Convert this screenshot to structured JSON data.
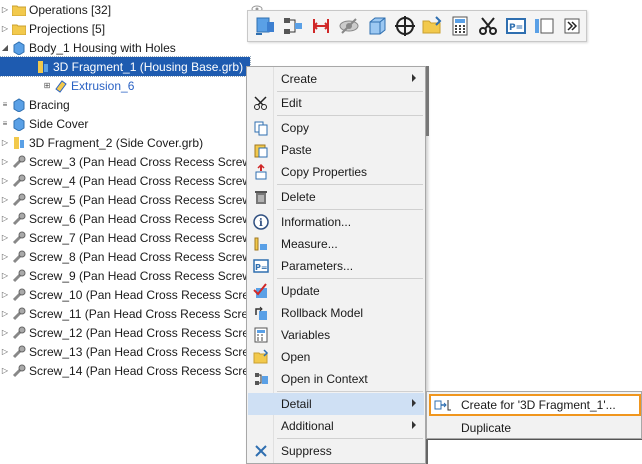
{
  "colors": {
    "selection": "#1e5bb0",
    "link": "#2a62c4",
    "menu_hover": "#cfe0f4",
    "submenu_focus": "#f0961e",
    "folder": "#f2c94c",
    "body_blue": "#5aa0e6"
  },
  "tree": {
    "rows": [
      {
        "label": "Operations [32]",
        "icon": "folder-icon",
        "expander": "▷"
      },
      {
        "label": "Projections [5]",
        "icon": "folder-icon",
        "expander": "▷"
      },
      {
        "label": "Body_1 Housing with Holes",
        "icon": "body-icon",
        "expander": "◢"
      },
      {
        "label": "3D Fragment_1 (Housing Base.grb)",
        "icon": "fragment-icon",
        "expander": "◢"
      },
      {
        "label": "Extrusion_6",
        "icon": "extrusion-icon",
        "expander": "⊞"
      },
      {
        "label": "Bracing",
        "icon": "body-icon",
        "expander": "≡"
      },
      {
        "label": "Side Cover",
        "icon": "body-icon",
        "expander": "≡"
      },
      {
        "label": "3D Fragment_2 (Side Cover.grb)",
        "icon": "fragment-icon",
        "expander": "▷"
      },
      {
        "label": "Screw_3 (Pan Head Cross Recess Screw I",
        "icon": "screw-icon",
        "expander": "▷"
      },
      {
        "label": "Screw_4 (Pan Head Cross Recess Screw I",
        "icon": "screw-icon",
        "expander": "▷"
      },
      {
        "label": "Screw_5 (Pan Head Cross Recess Screw I",
        "icon": "screw-icon",
        "expander": "▷"
      },
      {
        "label": "Screw_6 (Pan Head Cross Recess Screw I",
        "icon": "screw-icon",
        "expander": "▷"
      },
      {
        "label": "Screw_7 (Pan Head Cross Recess Screw I",
        "icon": "screw-icon",
        "expander": "▷"
      },
      {
        "label": "Screw_8 (Pan Head Cross Recess Screw I",
        "icon": "screw-icon",
        "expander": "▷"
      },
      {
        "label": "Screw_9 (Pan Head Cross Recess Screw I",
        "icon": "screw-icon",
        "expander": "▷"
      },
      {
        "label": "Screw_10 (Pan Head Cross Recess Screw",
        "icon": "screw-icon",
        "expander": "▷"
      },
      {
        "label": "Screw_11 (Pan Head Cross Recess Screw",
        "icon": "screw-icon",
        "expander": "▷"
      },
      {
        "label": "Screw_12 (Pan Head Cross Recess Screw",
        "icon": "screw-icon",
        "expander": "▷"
      },
      {
        "label": "Screw_13 (Pan Head Cross Recess Screw",
        "icon": "screw-icon",
        "expander": "▷"
      },
      {
        "label": "Screw_14 (Pan Head Cross Recess Screw",
        "icon": "screw-icon",
        "expander": "▷"
      }
    ]
  },
  "toolbar": {
    "buttons": [
      {
        "name": "cube-assembly-icon"
      },
      {
        "name": "node-tree-icon"
      },
      {
        "name": "dimension-arrows-icon"
      },
      {
        "name": "hide-eye-icon"
      },
      {
        "name": "cube-icon"
      },
      {
        "name": "crosshair-icon"
      },
      {
        "name": "open-folder-icon"
      },
      {
        "name": "calculator-icon"
      },
      {
        "name": "scissors-icon"
      },
      {
        "name": "parameters-icon"
      },
      {
        "name": "rectangle-icon"
      },
      {
        "name": "overflow-icon"
      }
    ]
  },
  "menu": {
    "items": [
      {
        "label": "Create",
        "icon": "",
        "submenu": true
      },
      {
        "label": "Edit",
        "icon": "edit-icon",
        "submenu": false
      },
      {
        "label": "Copy",
        "icon": "copy-icon",
        "submenu": false
      },
      {
        "label": "Paste",
        "icon": "paste-icon",
        "submenu": false
      },
      {
        "label": "Copy Properties",
        "icon": "copy-properties-icon",
        "submenu": false
      },
      {
        "label": "Delete",
        "icon": "trash-icon",
        "submenu": false
      },
      {
        "label": "Information...",
        "icon": "info-icon",
        "submenu": false
      },
      {
        "label": "Measure...",
        "icon": "measure-icon",
        "submenu": false
      },
      {
        "label": "Parameters...",
        "icon": "parameters-icon",
        "submenu": false
      },
      {
        "label": "Update",
        "icon": "update-icon",
        "submenu": false
      },
      {
        "label": "Rollback Model",
        "icon": "rollback-icon",
        "submenu": false
      },
      {
        "label": "Variables",
        "icon": "variables-icon",
        "submenu": false
      },
      {
        "label": "Open",
        "icon": "open-folder-icon",
        "submenu": false
      },
      {
        "label": "Open in Context",
        "icon": "open-context-icon",
        "submenu": false
      },
      {
        "label": "Detail",
        "icon": "",
        "submenu": true
      },
      {
        "label": "Additional",
        "icon": "",
        "submenu": true
      },
      {
        "label": "Suppress",
        "icon": "suppress-icon",
        "submenu": false
      }
    ]
  },
  "submenu": {
    "items": [
      {
        "label": "Create for '3D Fragment_1'...",
        "icon": "create-detail-icon"
      },
      {
        "label": "Duplicate",
        "icon": ""
      }
    ]
  }
}
